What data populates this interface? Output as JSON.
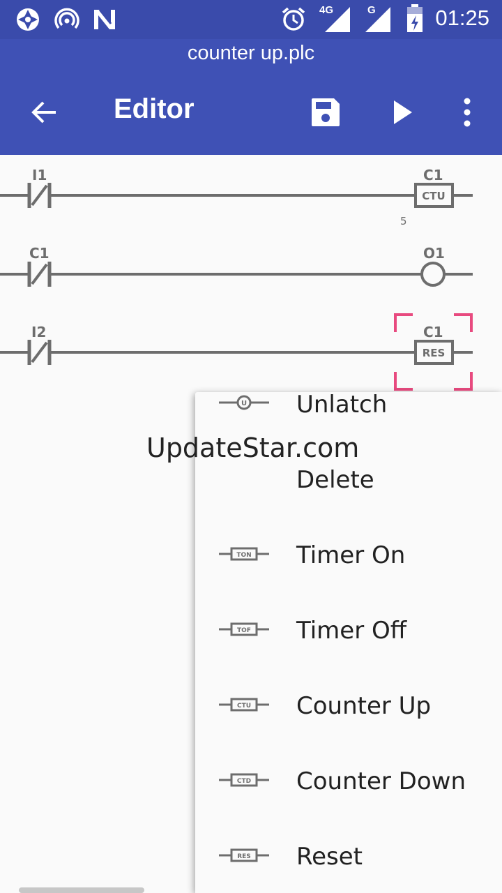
{
  "status_bar": {
    "time": "01:25",
    "network_4g": "4G",
    "network_g": "G",
    "icons": [
      "aperture-icon",
      "hotspot-icon",
      "n-logo-icon",
      "alarm-icon",
      "signal-4g-icon",
      "signal-g-icon",
      "battery-charging-icon"
    ]
  },
  "app_bar": {
    "file_name": "counter up.plc",
    "title": "Editor",
    "icons": [
      "back-arrow-icon",
      "save-icon",
      "play-icon",
      "more-vert-icon"
    ]
  },
  "ladder": {
    "rungs": [
      {
        "contact": "I1",
        "output_label": "C1",
        "output_type": "CTU",
        "preset": "5"
      },
      {
        "contact": "C1",
        "output_label": "O1",
        "output_type": "coil"
      },
      {
        "contact": "I2",
        "output_label": "C1",
        "output_type": "RES",
        "selected": true
      }
    ]
  },
  "menu": {
    "items": [
      {
        "label": "Unlatch",
        "icon": "unlatch-coil-icon",
        "icon_text": "U"
      },
      {
        "label": "Delete",
        "icon": ""
      },
      {
        "label": "Timer On",
        "icon": "timer-on-icon",
        "icon_text": "TON"
      },
      {
        "label": "Timer Off",
        "icon": "timer-off-icon",
        "icon_text": "TOF"
      },
      {
        "label": "Counter Up",
        "icon": "counter-up-icon",
        "icon_text": "CTU"
      },
      {
        "label": "Counter Down",
        "icon": "counter-down-icon",
        "icon_text": "CTD"
      },
      {
        "label": "Reset",
        "icon": "reset-icon",
        "icon_text": "RES"
      }
    ]
  },
  "watermark": "UpdateStar.com",
  "colors": {
    "primary": "#3f51b5",
    "status_bar": "#3a4bab",
    "ladder_line": "#6d6d6d",
    "selection": "#e84a7f"
  }
}
